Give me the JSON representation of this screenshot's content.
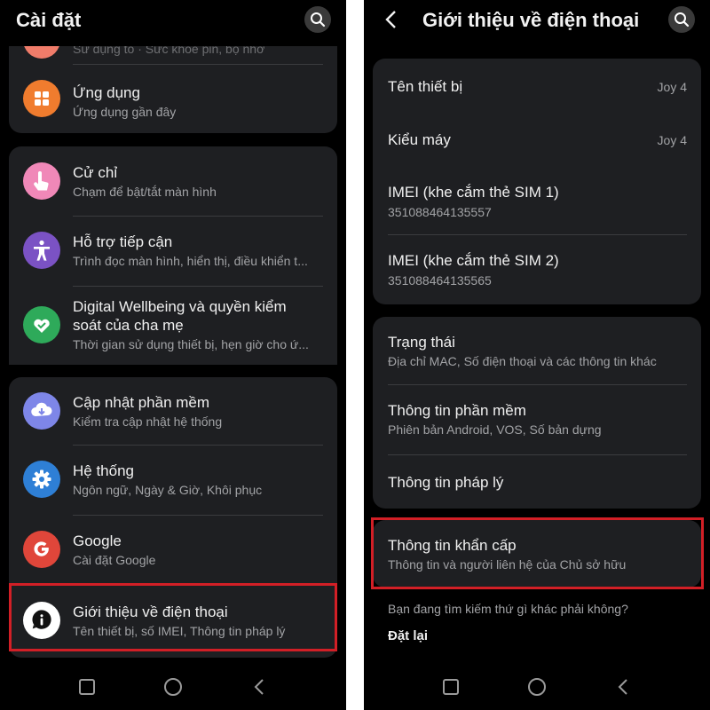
{
  "left": {
    "title": "Cài đặt",
    "partial_item": {
      "sub": "Sử dụng tổ · Sức khỏe pin, bộ nhớ"
    },
    "items": [
      {
        "title": "Ứng dụng",
        "sub": "Ứng dụng gần đây",
        "icon": "apps-icon",
        "color": "#f07c2e"
      },
      {
        "title": "Cử chỉ",
        "sub": "Chạm để bật/tắt màn hình",
        "icon": "gesture-hand-icon",
        "color": "#f088b8"
      },
      {
        "title": "Hỗ trợ tiếp cận",
        "sub": "Trình đọc màn hình, hiển thị, điều khiển t...",
        "icon": "accessibility-icon",
        "color": "#7b52c4"
      },
      {
        "title_line1": "Digital Wellbeing và quyền kiểm",
        "title_line2": "soát của cha mẹ",
        "sub": "Thời gian sử dụng thiết bị, hẹn giờ cho ứ...",
        "icon": "wellbeing-heart-icon",
        "color": "#2eaa5a"
      },
      {
        "title": "Cập nhật phần mềm",
        "sub": "Kiểm tra cập nhật hệ thống",
        "icon": "cloud-download-icon",
        "color": "#7e86e8"
      },
      {
        "title": "Hệ thống",
        "sub": "Ngôn ngữ, Ngày & Giờ, Khôi phục",
        "icon": "gear-icon",
        "color": "#2e7fd6"
      },
      {
        "title": "Google",
        "sub": "Cài đặt Google",
        "icon": "google-g-icon",
        "color": "#e0463a"
      },
      {
        "title": "Giới thiệu về điện thoại",
        "sub": "Tên thiết bị, số IMEI, Thông tin pháp lý",
        "icon": "info-icon",
        "color": "#ffffff"
      }
    ]
  },
  "right": {
    "title": "Giới thiệu về điện thoại",
    "device": [
      {
        "title": "Tên thiết bị",
        "value": "Joy 4"
      },
      {
        "title": "Kiểu máy",
        "value": "Joy 4"
      },
      {
        "title": "IMEI (khe cắm thẻ SIM 1)",
        "sub": "351088464135557"
      },
      {
        "title": "IMEI (khe cắm thẻ SIM 2)",
        "sub": "351088464135565"
      }
    ],
    "info": [
      {
        "title": "Trạng thái",
        "sub": "Địa chỉ MAC, Số điện thoại và các thông tin khác"
      },
      {
        "title": "Thông tin phần mềm",
        "sub": "Phiên bản Android, VOS, Số bản dựng"
      },
      {
        "title": "Thông tin pháp lý"
      }
    ],
    "emergency": {
      "title": "Thông tin khẩn cấp",
      "sub": "Thông tin và người liên hệ của Chủ sở hữu"
    },
    "suggest": "Bạn đang tìm kiếm thứ gì khác phải không?",
    "reset": "Đặt lại"
  },
  "colors": {
    "highlight": "#d21f26",
    "card": "#1e1f22",
    "background": "#000000"
  }
}
